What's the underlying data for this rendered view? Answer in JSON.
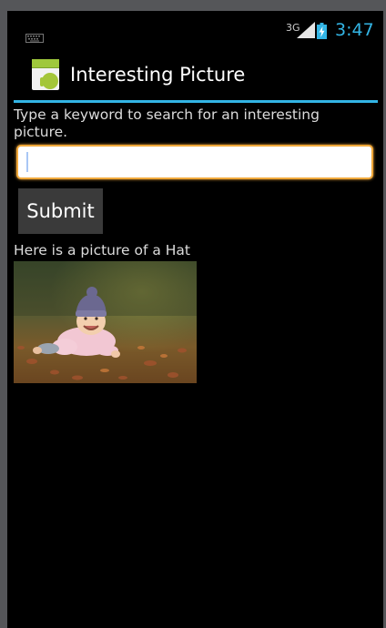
{
  "status_bar": {
    "keyboard_icon": "keyboard-icon",
    "network": "3G",
    "signal_icon": "signal-icon",
    "battery_icon": "battery-charging-icon",
    "time": "3:47",
    "accent_color": "#33b5e5"
  },
  "action_bar": {
    "app_icon": "android-app-icon",
    "title": "Interesting Picture"
  },
  "form": {
    "prompt": "Type a keyword to search for an interesting picture.",
    "input_value": "",
    "input_border_color": "#f0a83a",
    "submit_label": "Submit"
  },
  "result": {
    "caption": "Here is a picture of a Hat",
    "image": "photo of a smiling baby wearing a knit hat lying on autumn leaves"
  }
}
